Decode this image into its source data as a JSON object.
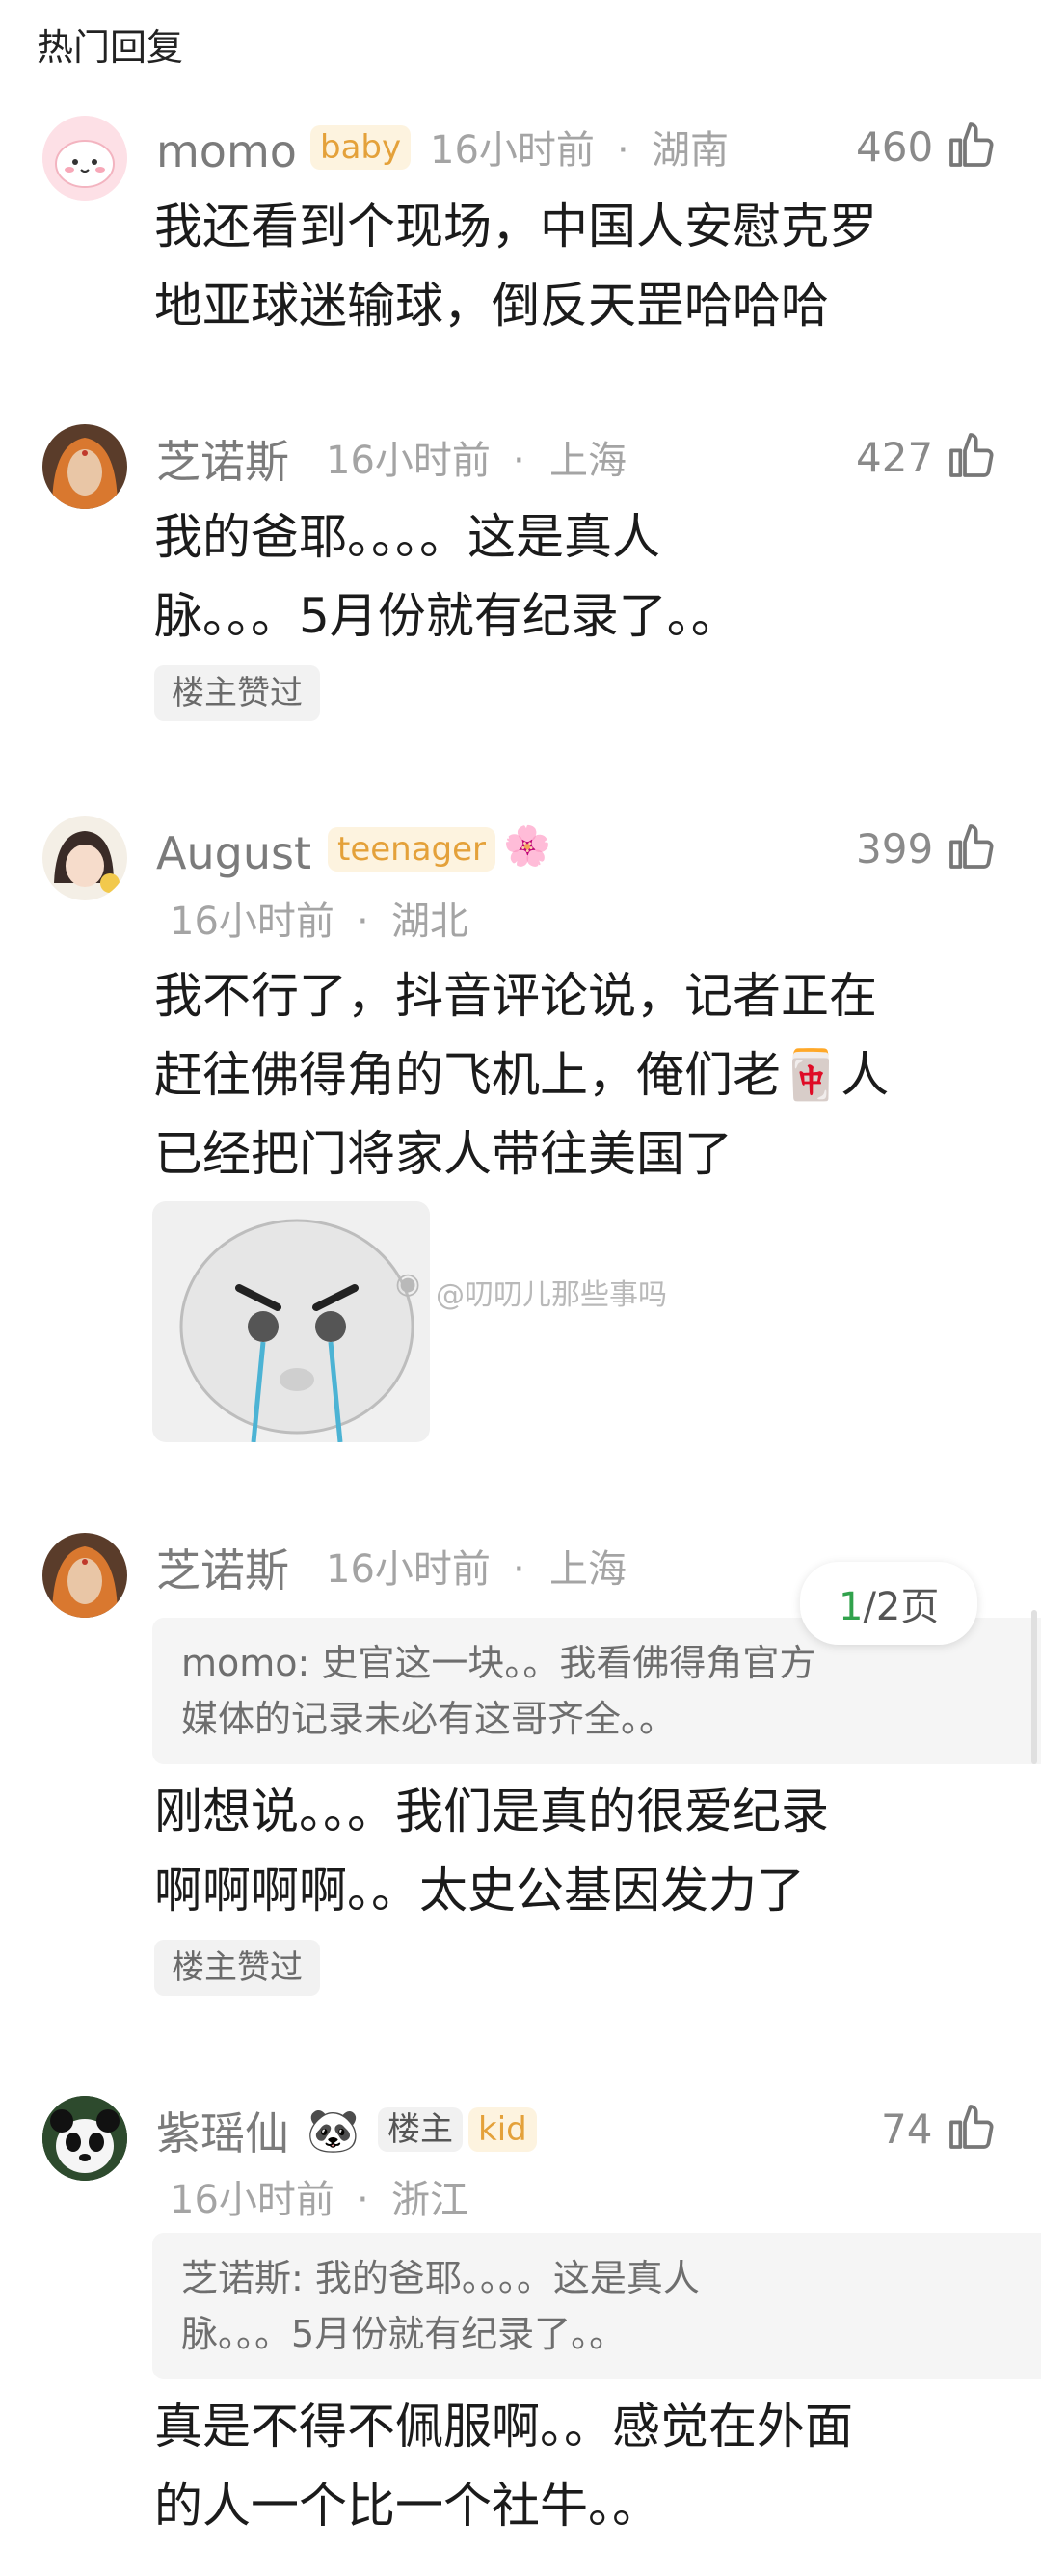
{
  "header": {
    "title": "热门回复"
  },
  "comments": [
    {
      "user": "momo",
      "badge": "baby",
      "time": "16小时前",
      "location": "湖南",
      "likes": "460",
      "lines": [
        "我还看到个现场，中国人安慰克罗",
        "地亚球迷输球，倒反天罡哈哈哈"
      ]
    },
    {
      "user": "芝诺斯",
      "time": "16小时前",
      "location": "上海",
      "likes": "427",
      "lines": [
        "我的爸耶。。。。这是真人",
        "脉。。。5月份就有纪录了。。"
      ],
      "owner_liked": "楼主赞过"
    },
    {
      "user": "August",
      "badge": "teenager",
      "time": "16小时前",
      "location": "湖北",
      "likes": "399",
      "lines": [
        "我不行了，抖音评论说，记者正在",
        "赶往佛得角的飞机上，俺们老",
        "人",
        "已经把门将家人带往美国了"
      ],
      "mahjong": "🀄"
    },
    {
      "user": "芝诺斯",
      "time": "16小时前",
      "location": "上海",
      "quote": [
        "momo: 史官这一块。。我看佛得角官方",
        "媒体的记录未必有这哥齐全。。"
      ],
      "lines": [
        "刚想说。。。我们是真的很爱纪录",
        "啊啊啊啊。。太史公基因发力了"
      ],
      "owner_liked": "楼主赞过"
    },
    {
      "user": "紫瑶仙",
      "emoji": "🐼",
      "owner_badge": "楼主",
      "badge": "kid",
      "time": "16小时前",
      "location": "浙江",
      "likes": "74",
      "quote": [
        "芝诺斯: 我的爸耶。。。。这是真人",
        "脉。。。5月份就有纪录了。。"
      ],
      "lines": [
        "真是不得不佩服啊。。感觉在外面",
        "的人一个比一个社牛。。"
      ]
    }
  ],
  "pager": {
    "current": "1",
    "total": "/2页"
  },
  "watermark": "@叨叨儿那些事吗",
  "separator": "·",
  "colors": {
    "badge_text": "#e4a13a",
    "pager_current": "#31a24c"
  }
}
